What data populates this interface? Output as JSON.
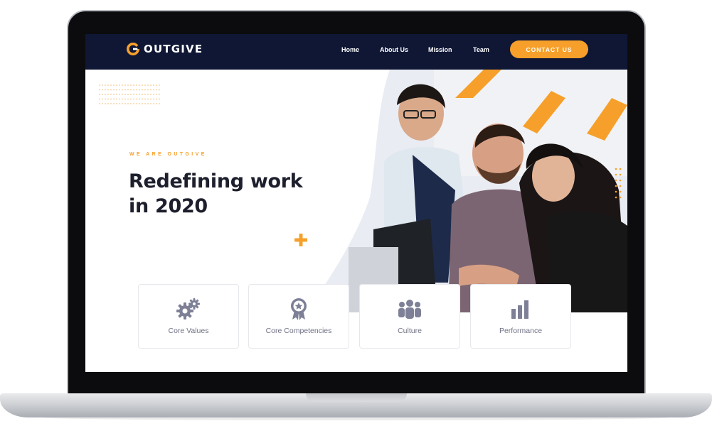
{
  "brand": {
    "name": "OUTGIVE",
    "accent": "#f6a02b",
    "nav_bg": "#0f1735"
  },
  "nav": {
    "links": [
      "Home",
      "About Us",
      "Mission",
      "Team"
    ],
    "cta_label": "CONTACT US"
  },
  "hero": {
    "eyebrow": "WE ARE OUTGIVE",
    "title_line1": "Redefining work",
    "title_line2": "in 2020",
    "image": "team-photo"
  },
  "cards": [
    {
      "label": "Core Values",
      "icon": "gears-icon"
    },
    {
      "label": "Core Competencies",
      "icon": "award-medal-icon"
    },
    {
      "label": "Culture",
      "icon": "people-group-icon"
    },
    {
      "label": "Performance",
      "icon": "bar-chart-icon"
    }
  ]
}
